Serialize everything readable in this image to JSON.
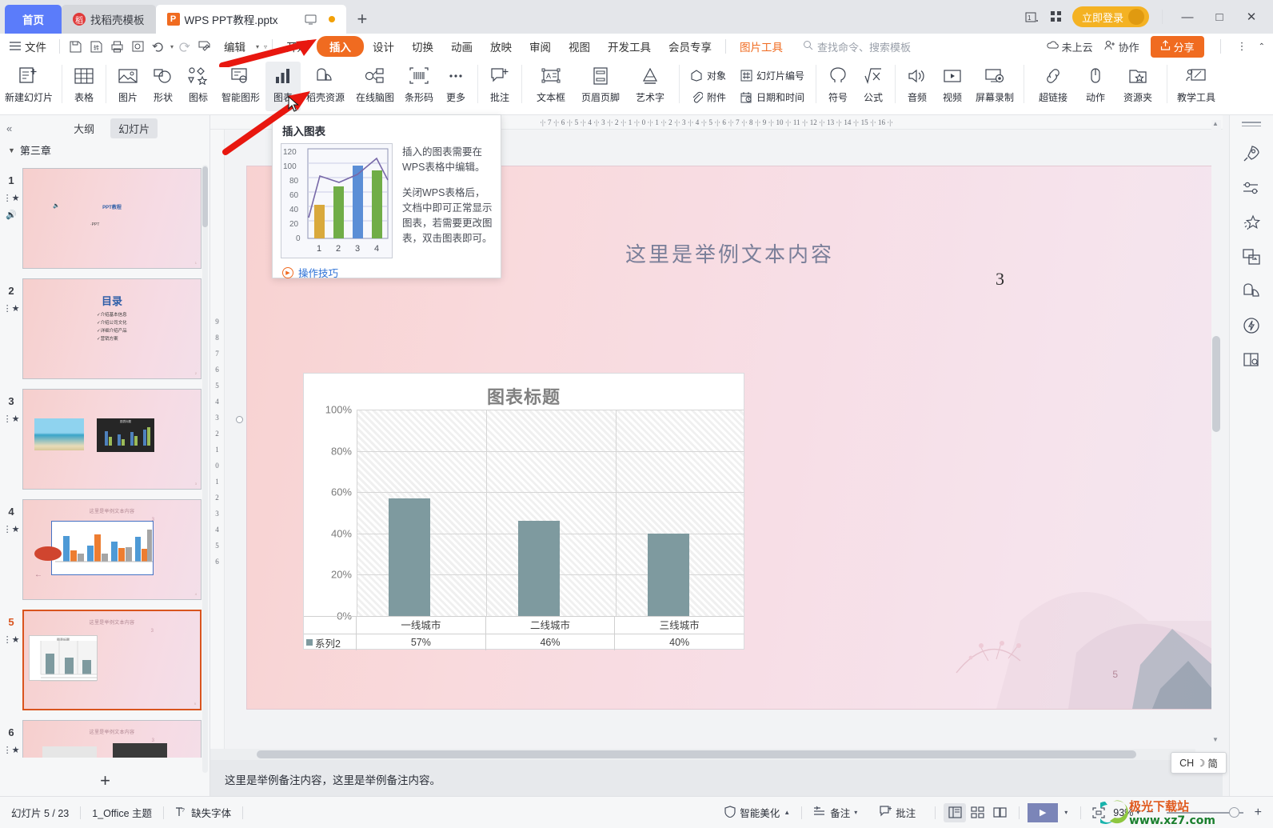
{
  "window": {
    "tabs": [
      {
        "label": "首页",
        "type": "home"
      },
      {
        "label": "找稻壳模板",
        "type": "template"
      },
      {
        "label": "WPS PPT教程.pptx",
        "type": "document",
        "active": true
      }
    ],
    "new_tab": "+",
    "login_label": "立即登录",
    "minimize": "—",
    "maximize": "□",
    "close": "✕"
  },
  "menubar": {
    "file_label": "文件",
    "edit_label": "编辑",
    "items": [
      "开始",
      "插入",
      "设计",
      "切换",
      "动画",
      "放映",
      "审阅",
      "视图",
      "开发工具",
      "会员专享"
    ],
    "active_item": "插入",
    "picture_tools": "图片工具",
    "search_placeholder": "查找命令、搜索模板",
    "cloud_status": "未上云",
    "collab_label": "协作",
    "share_label": "分享"
  },
  "ribbon": {
    "groups": [
      {
        "buttons": [
          {
            "label": "新建幻灯片",
            "icon": "new-slide-icon",
            "caret": true
          }
        ]
      },
      {
        "buttons": [
          {
            "label": "表格",
            "icon": "table-icon",
            "caret": true
          }
        ]
      },
      {
        "buttons": [
          {
            "label": "图片",
            "icon": "picture-icon",
            "caret": true
          },
          {
            "label": "形状",
            "icon": "shape-icon",
            "caret": true
          },
          {
            "label": "图标",
            "icon": "icons-icon",
            "caret": true
          },
          {
            "label": "智能图形",
            "icon": "smartart-icon",
            "caret": false
          },
          {
            "label": "图表",
            "icon": "chart-icon",
            "caret": false,
            "highlighted": true
          },
          {
            "label": "稻壳资源",
            "icon": "docer-resource-icon",
            "caret": false
          },
          {
            "label": "在线脑图",
            "icon": "mindmap-icon",
            "caret": false
          },
          {
            "label": "条形码",
            "icon": "barcode-icon",
            "caret": false
          },
          {
            "label": "更多",
            "icon": "more-icon",
            "caret": true
          }
        ]
      },
      {
        "buttons": [
          {
            "label": "批注",
            "icon": "comment-icon",
            "caret": false
          }
        ]
      },
      {
        "buttons": [
          {
            "label": "文本框",
            "icon": "textbox-icon",
            "caret": true
          },
          {
            "label": "页眉页脚",
            "icon": "header-footer-icon",
            "caret": false
          },
          {
            "label": "艺术字",
            "icon": "wordart-icon",
            "caret": true
          }
        ]
      },
      {
        "stacks": [
          {
            "rows": [
              {
                "label": "对象",
                "icon": "object-icon"
              },
              {
                "label": "附件",
                "icon": "attachment-icon"
              }
            ]
          },
          {
            "rows": [
              {
                "label": "幻灯片编号",
                "icon": "slide-number-icon"
              },
              {
                "label": "日期和时间",
                "icon": "date-time-icon"
              }
            ]
          }
        ]
      },
      {
        "buttons": [
          {
            "label": "符号",
            "icon": "symbol-icon",
            "caret": true
          },
          {
            "label": "公式",
            "icon": "formula-icon",
            "caret": true
          }
        ]
      },
      {
        "buttons": [
          {
            "label": "音频",
            "icon": "audio-icon",
            "caret": true
          },
          {
            "label": "视频",
            "icon": "video-icon",
            "caret": true
          },
          {
            "label": "屏幕录制",
            "icon": "screen-record-icon",
            "caret": false
          }
        ]
      },
      {
        "buttons": [
          {
            "label": "超链接",
            "icon": "hyperlink-icon",
            "caret": true
          },
          {
            "label": "动作",
            "icon": "action-icon",
            "caret": false
          },
          {
            "label": "资源夹",
            "icon": "resource-folder-icon",
            "caret": false
          }
        ]
      },
      {
        "buttons": [
          {
            "label": "教学工具",
            "icon": "teaching-tools-icon",
            "caret": false
          }
        ]
      }
    ],
    "quick_access": [
      "save-icon",
      "save-as-icon",
      "print-icon",
      "print-preview-icon",
      "undo-icon",
      "redo-icon",
      "format-painter-icon"
    ]
  },
  "tooltip": {
    "title": "插入图表",
    "paragraph1": "插入的图表需要在WPS表格中编辑。",
    "paragraph2": "关闭WPS表格后，文档中即可正常显示图表，若需要更改图表，双击图表即可。",
    "link": "操作技巧",
    "preview_chart": {
      "type": "bar",
      "categories": [
        "1",
        "2",
        "3",
        "4"
      ],
      "values": [
        45,
        70,
        98,
        91
      ],
      "line_values": [
        28,
        83,
        78,
        107
      ],
      "colors": [
        "#d9a93c",
        "#70ad47",
        "#5b8ed6",
        "#70ad47"
      ],
      "line_color": "#7768a8",
      "yticks": [
        "120",
        "100",
        "80",
        "60",
        "40",
        "20",
        "0"
      ],
      "ylim": [
        0,
        120
      ]
    }
  },
  "left_pane": {
    "collapse_icon": "collapse-left-icon",
    "tabs": [
      "大纲",
      "幻灯片"
    ],
    "selected_tab": "幻灯片",
    "section": "第三章",
    "slides": [
      {
        "number": "1",
        "title": "PPT教程",
        "subtitle": "·PPT",
        "kind": "title"
      },
      {
        "number": "2",
        "title": "目录",
        "kind": "toc",
        "bullets": [
          "介绍基本信息",
          "介绍公司文化",
          "详细介绍产品",
          "营销方案"
        ]
      },
      {
        "number": "3",
        "kind": "image-chart"
      },
      {
        "number": "4",
        "title": "这里是举例文本内容",
        "page": "3",
        "kind": "chart-multi"
      },
      {
        "number": "5",
        "title": "这里是举例文本内容",
        "page": "3",
        "kind": "chart-single",
        "current": true
      },
      {
        "number": "6",
        "title": "这里是举例文本内容",
        "page": "3",
        "kind": "dark-chart"
      }
    ],
    "add_slide": "+"
  },
  "ruler": {
    "horizontal": "·|· 7 ·|· 6 ·|· 5 ·|· 4 ·|· 3 ·|· 2 ·|· 1 ·|· 0 ·|· 1 ·|· 2 ·|· 3 ·|· 4 ·|· 5 ·|· 6 ·|· 7 ·|· 8 ·|· 9 ·|· 10 ·|· 11 ·|· 12 ·|· 13 ·|· 14 ·|· 15 ·|· 16 ·|·",
    "vertical": [
      "9",
      "8",
      "7",
      "6",
      "5",
      "4",
      "3",
      "2",
      "1",
      "0",
      "1",
      "2",
      "3",
      "4",
      "5",
      "6",
      "7",
      "8"
    ]
  },
  "slide": {
    "title": "这里是举例文本内容",
    "page_number": "3",
    "corner_number": "5"
  },
  "chart_data": {
    "type": "bar",
    "title": "图表标题",
    "categories": [
      "一线城市",
      "二线城市",
      "三线城市"
    ],
    "series": [
      {
        "name": "系列2",
        "values": [
          57,
          46,
          40
        ],
        "labels": [
          "57%",
          "46%",
          "40%"
        ],
        "color": "#7e9a9f"
      }
    ],
    "yticks": [
      "100%",
      "80%",
      "60%",
      "40%",
      "20%",
      "0%"
    ],
    "ylim": [
      0,
      100
    ],
    "xlabel": "",
    "ylabel": "",
    "grid": true,
    "legend_position": "data-table",
    "has_data_table": true
  },
  "notes": {
    "text": "这里是举例备注内容，这里是举例备注内容。"
  },
  "ime": {
    "lang": "CH",
    "mode": "简",
    "moon": "☽"
  },
  "right_rail": {
    "icons": [
      "rocket-icon",
      "settings-sliders-icon",
      "magic-star-icon",
      "replace-image-icon",
      "docer-material-icon",
      "flash-idea-icon",
      "book-search-icon"
    ]
  },
  "status_bar": {
    "slide_counter": "幻灯片 5 / 23",
    "theme": "1_Office 主题",
    "missing_font": "缺失字体",
    "beautify": "智能美化",
    "notes_btn": "备注",
    "comment_btn": "批注",
    "zoom": "93%",
    "zoom_out": "−",
    "zoom_in": "+",
    "view_icons": [
      "normal-view-icon",
      "slide-sorter-icon",
      "reading-view-icon"
    ],
    "play_icon": "play-icon"
  },
  "watermark": {
    "text": "极光下载站",
    "url": "www.xz7.com"
  },
  "colors": {
    "accent_orange": "#f06b20",
    "tab_blue": "#5b7cfa",
    "login_yellow": "#f4b223",
    "bar_teal": "#7e9a9f",
    "slide_bg": "#f8d2d1",
    "arrow_red": "#e8170f"
  }
}
